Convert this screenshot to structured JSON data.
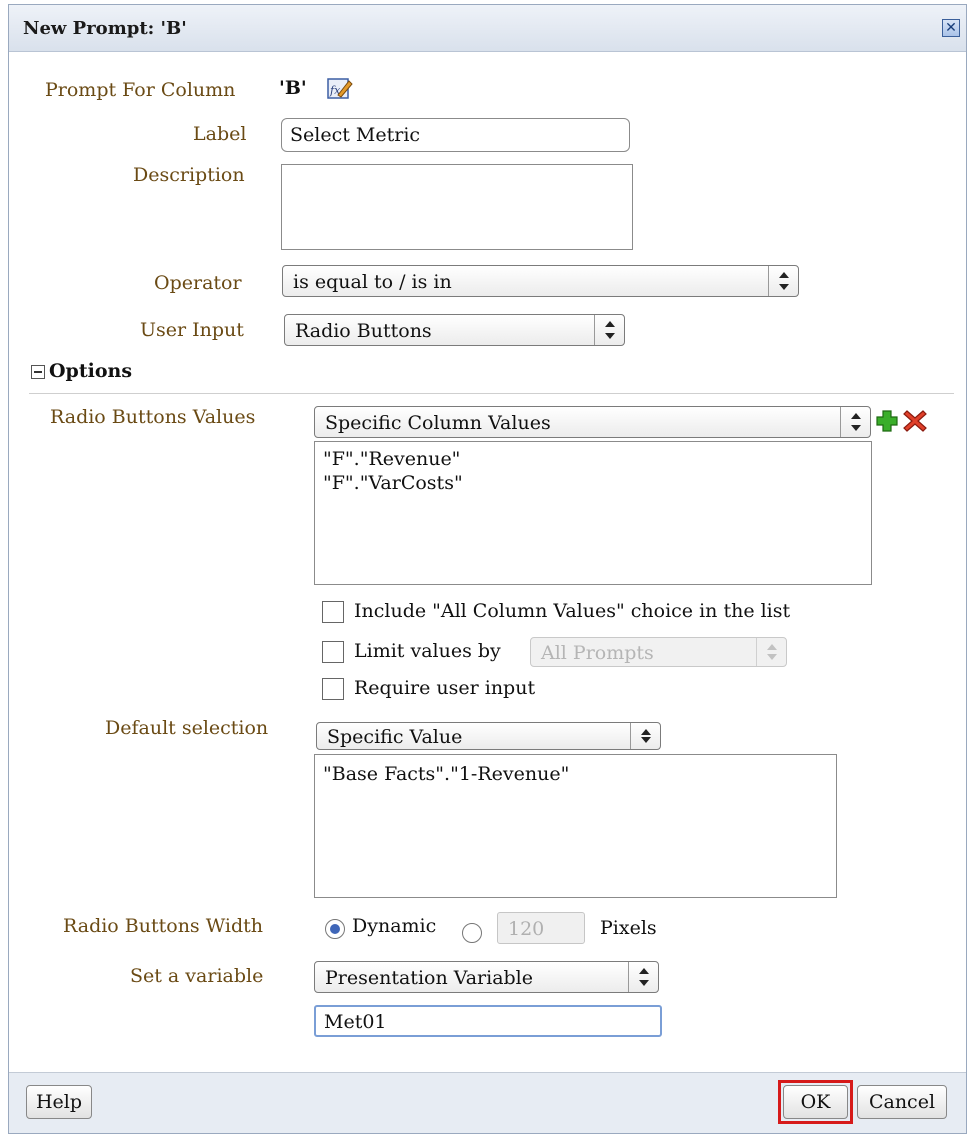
{
  "dialog": {
    "title": "New Prompt: 'B'",
    "close_icon": "close-icon"
  },
  "prompt_for_column": {
    "label": "Prompt For Column",
    "value": "'B'",
    "edit_icon": "edit-formula-icon"
  },
  "label_field": {
    "label": "Label",
    "value": "Select Metric"
  },
  "description": {
    "label": "Description",
    "value": ""
  },
  "operator": {
    "label": "Operator",
    "value": "is equal to / is in"
  },
  "user_input": {
    "label": "User Input",
    "value": "Radio Buttons"
  },
  "options": {
    "header": "Options",
    "radio_values": {
      "label": "Radio Buttons Values",
      "select": "Specific Column Values",
      "items": [
        "\"F\".\"Revenue\"",
        "\"F\".\"VarCosts\""
      ],
      "add_icon": "plus-icon",
      "delete_icon": "delete-x-icon"
    },
    "include_all": {
      "label": "Include \"All Column Values\" choice in the list",
      "checked": false
    },
    "limit_values": {
      "label": "Limit values by",
      "select": "All Prompts",
      "checked": false,
      "enabled": false
    },
    "require_input": {
      "label": "Require user input",
      "checked": false
    },
    "default_selection": {
      "label": "Default selection",
      "select": "Specific Value",
      "items": [
        "\"Base Facts\".\"1-Revenue\""
      ]
    },
    "width": {
      "label": "Radio Buttons Width",
      "dynamic_label": "Dynamic",
      "dynamic_selected": true,
      "pixels_value": "120",
      "pixels_label": "Pixels"
    },
    "variable": {
      "label": "Set a variable",
      "select": "Presentation Variable",
      "value": "Met01"
    }
  },
  "footer": {
    "help": "Help",
    "ok": "OK",
    "cancel": "Cancel"
  },
  "colors": {
    "label_brown": "#6a4a14",
    "highlight_red": "#d61a1a",
    "title_bar": "#d9e1ec"
  }
}
